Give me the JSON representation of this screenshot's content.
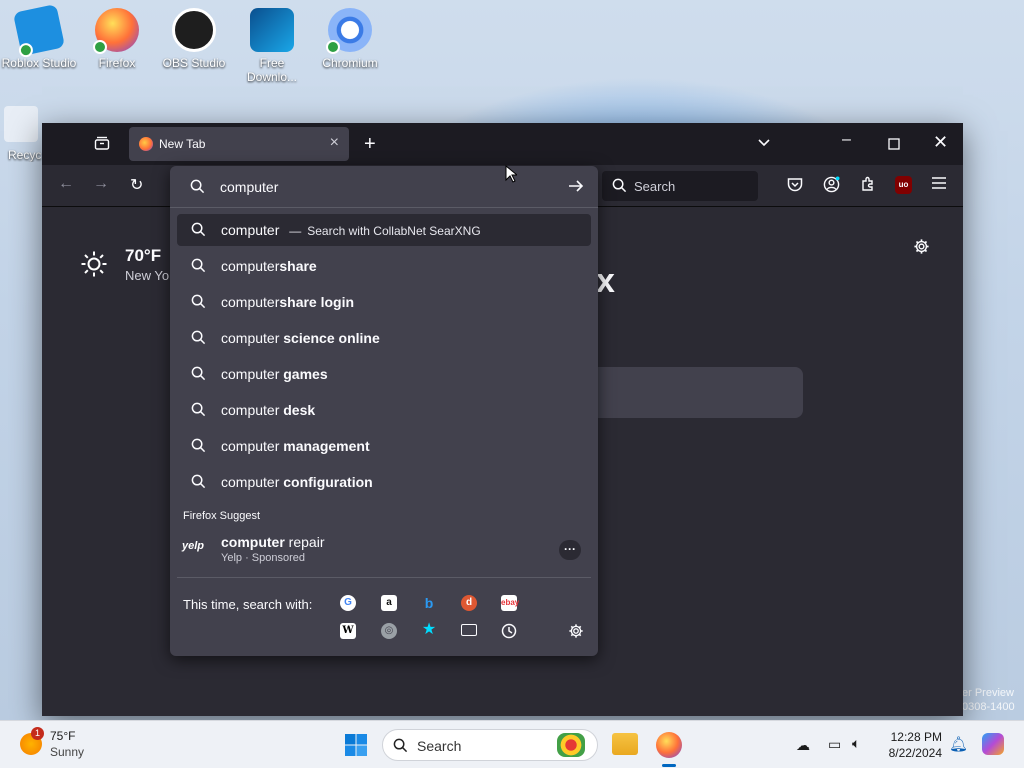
{
  "desktop": {
    "icons": [
      {
        "label": "Roblox Studio"
      },
      {
        "label": "Firefox"
      },
      {
        "label": "OBS Studio"
      },
      {
        "label": "Free Downlo..."
      },
      {
        "label": "Chromium"
      },
      {
        "label": "Recyc"
      }
    ],
    "watermark": [
      "er Preview",
      "0308-1400"
    ]
  },
  "browser": {
    "tab_title": "New Tab",
    "search_placeholder": "Search",
    "urlbar_value": "computer",
    "top_suggestion": {
      "term": "computer",
      "dash": "—",
      "engine_text": "Search with CollabNet SearXNG"
    },
    "suggestions": [
      {
        "prefix": "computer",
        "bold": "share"
      },
      {
        "prefix": "computer",
        "bold": "share login"
      },
      {
        "prefix": "computer ",
        "bold": "science online"
      },
      {
        "prefix": "computer ",
        "bold": "games"
      },
      {
        "prefix": "computer ",
        "bold": "desk"
      },
      {
        "prefix": "computer ",
        "bold": "management"
      },
      {
        "prefix": "computer ",
        "bold": "configuration"
      }
    ],
    "suggest_section_label": "Firefox Suggest",
    "sponsored": {
      "logo": "yelp",
      "bold": "computer",
      "rest": " repair",
      "meta": "Yelp · Sponsored"
    },
    "search_with_label": "This time, search with:",
    "engines_row1": [
      "google-icon",
      "amazon-icon",
      "bing-icon",
      "duckduckgo-icon",
      "ebay-icon"
    ],
    "engines_row2": [
      "wikipedia-icon",
      "searxng-icon",
      "bookmarks-icon",
      "tabs-icon",
      "history-icon"
    ],
    "newtab": {
      "temperature": "70°F",
      "location": "New Yo",
      "logo_fragment": "x"
    }
  },
  "taskbar": {
    "weather_temp": "75°F",
    "weather_desc": "Sunny",
    "weather_badge": "1",
    "search_placeholder": "Search",
    "time": "12:28 PM",
    "date": "8/22/2024"
  }
}
